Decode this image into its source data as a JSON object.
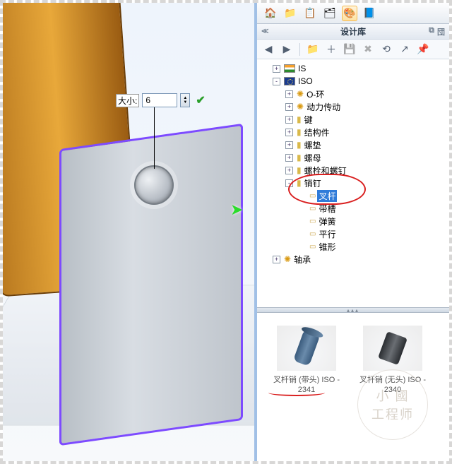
{
  "dimension": {
    "label": "大小:",
    "value": "6"
  },
  "tabbar": [
    "home-icon",
    "folder-icon",
    "clipboard-icon",
    "table-icon",
    "palette-icon",
    "book-icon"
  ],
  "panel": {
    "title": "设计库",
    "corner_glyphs": [
      "⧉",
      "団"
    ]
  },
  "toolbar": [
    {
      "name": "back",
      "glyph": "◀",
      "disabled": false
    },
    {
      "name": "fwd",
      "glyph": "▶",
      "disabled": false
    },
    {
      "name": "sep",
      "glyph": ""
    },
    {
      "name": "addlib",
      "glyph": "📁",
      "disabled": false
    },
    {
      "name": "addfile",
      "glyph": "＋",
      "disabled": false
    },
    {
      "name": "save",
      "glyph": "💾",
      "disabled": true
    },
    {
      "name": "delete",
      "glyph": "✖",
      "disabled": true
    },
    {
      "name": "refresh",
      "glyph": "⟲",
      "disabled": false
    },
    {
      "name": "web",
      "glyph": "↗",
      "disabled": false
    },
    {
      "name": "thumbtack",
      "glyph": "📌",
      "disabled": false
    }
  ],
  "tree": [
    {
      "depth": 1,
      "toggle": "+",
      "icon": "flag",
      "label": "IS"
    },
    {
      "depth": 1,
      "toggle": "-",
      "icon": "eu",
      "label": "ISO"
    },
    {
      "depth": 2,
      "toggle": "+",
      "icon": "gear",
      "label": "O-环"
    },
    {
      "depth": 2,
      "toggle": "+",
      "icon": "gear",
      "label": "动力传动"
    },
    {
      "depth": 2,
      "toggle": "+",
      "icon": "fold",
      "label": "键"
    },
    {
      "depth": 2,
      "toggle": "+",
      "icon": "fold",
      "label": "结构件"
    },
    {
      "depth": 2,
      "toggle": "+",
      "icon": "fold",
      "label": "螺垫"
    },
    {
      "depth": 2,
      "toggle": "+",
      "icon": "fold",
      "label": "螺母"
    },
    {
      "depth": 2,
      "toggle": "+",
      "icon": "fold",
      "label": "螺栓和螺钉"
    },
    {
      "depth": 2,
      "toggle": "-",
      "icon": "fold",
      "label": "销钉"
    },
    {
      "depth": 3,
      "toggle": "",
      "icon": "cyl",
      "label": "叉杆",
      "selected": true
    },
    {
      "depth": 3,
      "toggle": "",
      "icon": "cyl",
      "label": "带槽"
    },
    {
      "depth": 3,
      "toggle": "",
      "icon": "cyl",
      "label": "弹簧"
    },
    {
      "depth": 3,
      "toggle": "",
      "icon": "cyl",
      "label": "平行"
    },
    {
      "depth": 3,
      "toggle": "",
      "icon": "cyl",
      "label": "锥形"
    },
    {
      "depth": 1,
      "toggle": "+",
      "icon": "gear",
      "label": "轴承"
    }
  ],
  "thumbs": [
    {
      "name": "pin-with-head",
      "caption": "叉杆销 (带头) ISO - 2341"
    },
    {
      "name": "pin-no-head",
      "caption": "叉杆销 (无头) ISO - 2340"
    }
  ],
  "watermark": {
    "line1": "小 國",
    "line2": "工程师"
  }
}
